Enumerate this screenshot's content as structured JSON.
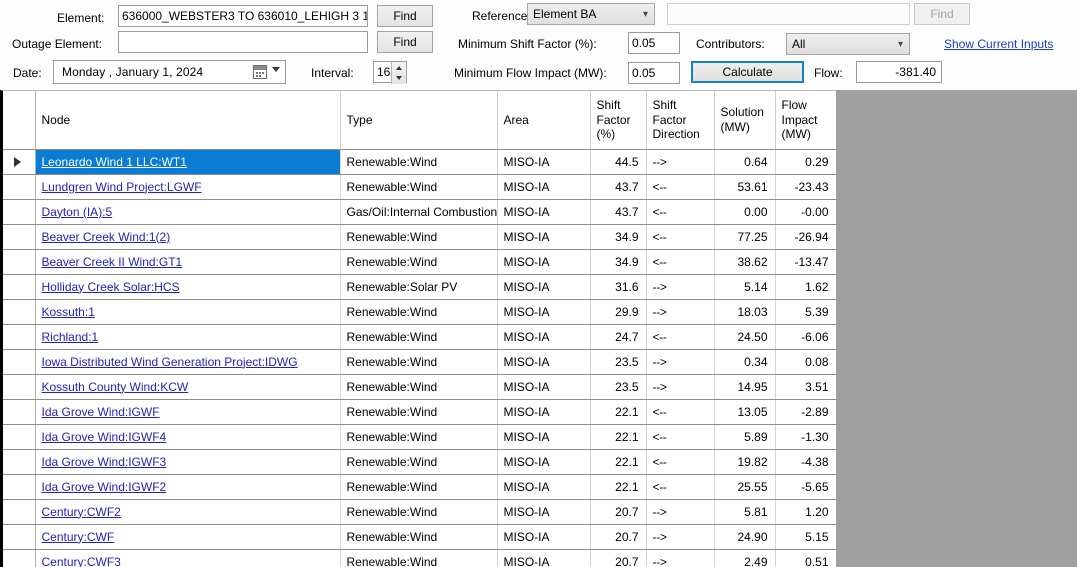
{
  "toolbar": {
    "element_label": "Element:",
    "element_value": "636000_WEBSTER3 TO 636010_LEHIGH 3 1",
    "element_placeholder": "",
    "find_label_1": "Find",
    "outage_label": "Outage Element:",
    "outage_value": "",
    "outage_placeholder": "",
    "find_label_2": "Find",
    "date_label": "Date:",
    "date_value": "Monday    ,  January      1, 2024",
    "interval_label": "Interval:",
    "interval_value": "16",
    "reference_label": "Reference:",
    "reference_value": "Element BA",
    "reference_find_value": "",
    "reference_find_placeholder": "",
    "find_label_3": "Find",
    "min_shift_factor_label": "Minimum Shift Factor (%):",
    "min_shift_factor_value": "0.05",
    "min_flow_impact_label": "Minimum Flow Impact (MW):",
    "min_flow_impact_value": "0.05",
    "contributors_label": "Contributors:",
    "contributors_value": "All",
    "calculate_label": "Calculate",
    "flow_label": "Flow:",
    "flow_value": "-381.40",
    "show_current_inputs_label": "Show Current Inputs",
    "accent_color": "#1a7fc1",
    "link_color": "#1a3ec8",
    "selection_color": "#0a7cd4"
  },
  "grid": {
    "columns": [
      {
        "key": "selector",
        "label": ""
      },
      {
        "key": "node",
        "label": "Node"
      },
      {
        "key": "type",
        "label": "Type"
      },
      {
        "key": "area",
        "label": "Area"
      },
      {
        "key": "shift_factor",
        "label": "Shift\nFactor\n(%)"
      },
      {
        "key": "shift_factor_direction",
        "label": "Shift\nFactor\nDirection"
      },
      {
        "key": "solution",
        "label": "Solution\n(MW)"
      },
      {
        "key": "flow_impact",
        "label": "Flow\nImpact\n(MW)"
      }
    ],
    "selected_row_index": 0,
    "rows": [
      {
        "node": "Leonardo Wind 1 LLC:WT1",
        "type": "Renewable:Wind",
        "area": "MISO-IA",
        "shift_factor": "44.5",
        "shift_factor_direction": "-->",
        "solution": "0.64",
        "flow_impact": "0.29"
      },
      {
        "node": "Lundgren  Wind Project:LGWF",
        "type": "Renewable:Wind",
        "area": "MISO-IA",
        "shift_factor": "43.7",
        "shift_factor_direction": "<--",
        "solution": "53.61",
        "flow_impact": "-23.43"
      },
      {
        "node": "Dayton (IA):5",
        "type": "Gas/Oil:Internal Combustion",
        "area": "MISO-IA",
        "shift_factor": "43.7",
        "shift_factor_direction": "<--",
        "solution": "0.00",
        "flow_impact": "-0.00"
      },
      {
        "node": "Beaver Creek Wind:1(2)",
        "type": "Renewable:Wind",
        "area": "MISO-IA",
        "shift_factor": "34.9",
        "shift_factor_direction": "<--",
        "solution": "77.25",
        "flow_impact": "-26.94"
      },
      {
        "node": "Beaver Creek II Wind:GT1",
        "type": "Renewable:Wind",
        "area": "MISO-IA",
        "shift_factor": "34.9",
        "shift_factor_direction": "<--",
        "solution": "38.62",
        "flow_impact": "-13.47"
      },
      {
        "node": "Holliday Creek Solar:HCS",
        "type": "Renewable:Solar PV",
        "area": "MISO-IA",
        "shift_factor": "31.6",
        "shift_factor_direction": "-->",
        "solution": "5.14",
        "flow_impact": "1.62"
      },
      {
        "node": "Kossuth:1",
        "type": "Renewable:Wind",
        "area": "MISO-IA",
        "shift_factor": "29.9",
        "shift_factor_direction": "-->",
        "solution": "18.03",
        "flow_impact": "5.39"
      },
      {
        "node": "Richland:1",
        "type": "Renewable:Wind",
        "area": "MISO-IA",
        "shift_factor": "24.7",
        "shift_factor_direction": "<--",
        "solution": "24.50",
        "flow_impact": "-6.06"
      },
      {
        "node": "Iowa Distributed Wind Generation Project:IDWG",
        "type": "Renewable:Wind",
        "area": "MISO-IA",
        "shift_factor": "23.5",
        "shift_factor_direction": "-->",
        "solution": "0.34",
        "flow_impact": "0.08"
      },
      {
        "node": "Kossuth County Wind:KCW",
        "type": "Renewable:Wind",
        "area": "MISO-IA",
        "shift_factor": "23.5",
        "shift_factor_direction": "-->",
        "solution": "14.95",
        "flow_impact": "3.51"
      },
      {
        "node": "Ida Grove Wind:IGWF",
        "type": "Renewable:Wind",
        "area": "MISO-IA",
        "shift_factor": "22.1",
        "shift_factor_direction": "<--",
        "solution": "13.05",
        "flow_impact": "-2.89"
      },
      {
        "node": "Ida Grove Wind:IGWF4",
        "type": "Renewable:Wind",
        "area": "MISO-IA",
        "shift_factor": "22.1",
        "shift_factor_direction": "<--",
        "solution": "5.89",
        "flow_impact": "-1.30"
      },
      {
        "node": "Ida Grove Wind:IGWF3",
        "type": "Renewable:Wind",
        "area": "MISO-IA",
        "shift_factor": "22.1",
        "shift_factor_direction": "<--",
        "solution": "19.82",
        "flow_impact": "-4.38"
      },
      {
        "node": "Ida Grove Wind:IGWF2",
        "type": "Renewable:Wind",
        "area": "MISO-IA",
        "shift_factor": "22.1",
        "shift_factor_direction": "<--",
        "solution": "25.55",
        "flow_impact": "-5.65"
      },
      {
        "node": "Century:CWF2",
        "type": "Renewable:Wind",
        "area": "MISO-IA",
        "shift_factor": "20.7",
        "shift_factor_direction": "-->",
        "solution": "5.81",
        "flow_impact": "1.20"
      },
      {
        "node": "Century:CWF",
        "type": "Renewable:Wind",
        "area": "MISO-IA",
        "shift_factor": "20.7",
        "shift_factor_direction": "-->",
        "solution": "24.90",
        "flow_impact": "5.15"
      },
      {
        "node": "Century:CWF3",
        "type": "Renewable:Wind",
        "area": "MISO-IA",
        "shift_factor": "20.7",
        "shift_factor_direction": "-->",
        "solution": "2.49",
        "flow_impact": "0.51"
      }
    ]
  }
}
